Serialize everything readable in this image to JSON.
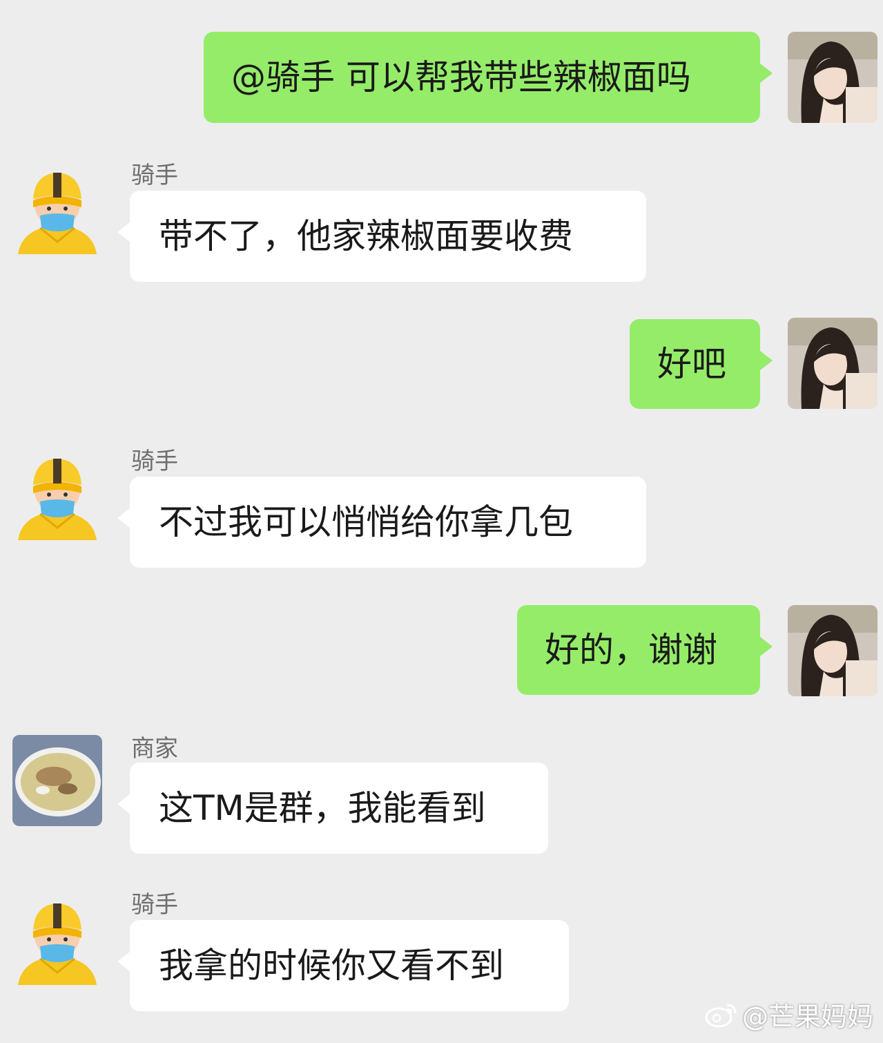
{
  "messages": [
    {
      "sender": "",
      "text": "@骑手 可以帮我带些辣椒面吗"
    },
    {
      "sender": "骑手",
      "text": "带不了，他家辣椒面要收费"
    },
    {
      "sender": "",
      "text": "好吧"
    },
    {
      "sender": "骑手",
      "text": "不过我可以悄悄给你拿几包"
    },
    {
      "sender": "",
      "text": "好的，谢谢"
    },
    {
      "sender": "商家",
      "text": "这TM是群，我能看到"
    },
    {
      "sender": "骑手",
      "text": "我拿的时候你又看不到"
    }
  ],
  "watermark": {
    "text": "@芒果妈妈",
    "icon": "weibo-icon"
  },
  "colors": {
    "outgoing_bubble": "#95ec69",
    "incoming_bubble": "#ffffff",
    "background": "#ededed"
  }
}
